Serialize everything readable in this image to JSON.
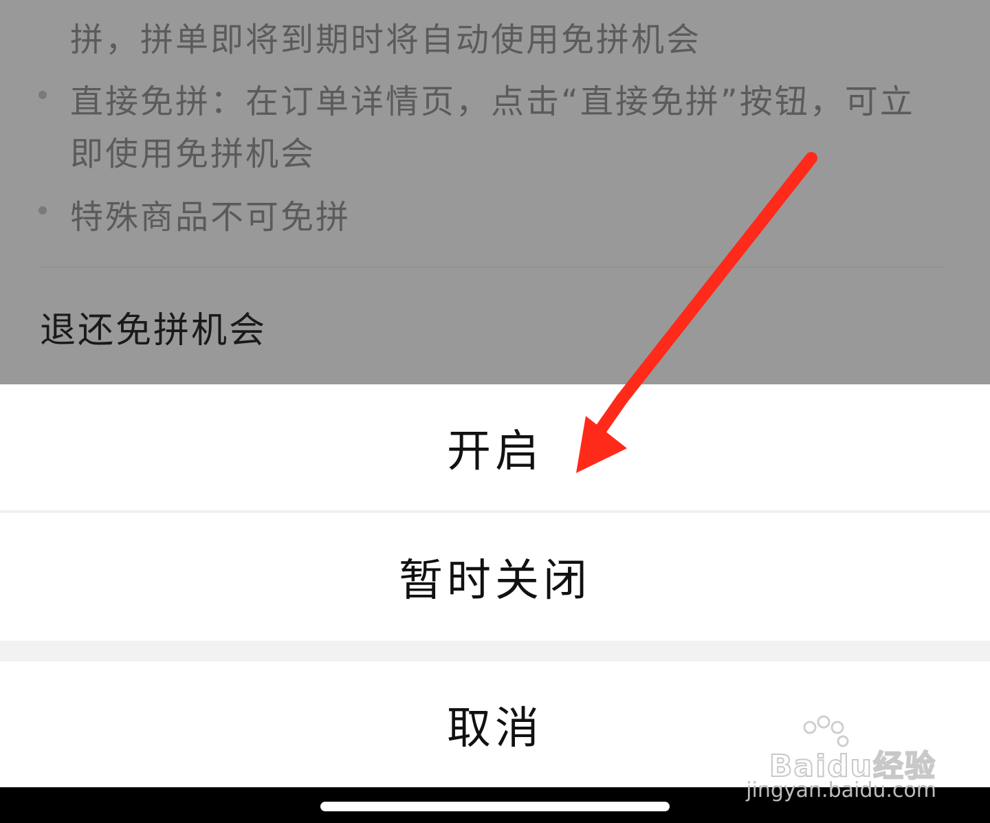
{
  "background_text": {
    "line1": "拼，拼单即将到期时将自动使用免拼机会",
    "bullet2_line1": "直接免拼：在订单详情页，点击“直接免拼”按钮，可立",
    "bullet2_line2": "即使用免拼机会",
    "bullet3": "特殊商品不可免拼",
    "section_title": "退还免拼机会"
  },
  "action_sheet": {
    "option_enable": "开启",
    "option_pause": "暂时关闭",
    "option_cancel": "取消"
  },
  "watermark": {
    "logo": "Baidu经验",
    "url": "jingyan.baidu.com"
  },
  "colors": {
    "overlay": "#999999",
    "sheet": "#ffffff",
    "arrow": "#ff2a1a"
  }
}
